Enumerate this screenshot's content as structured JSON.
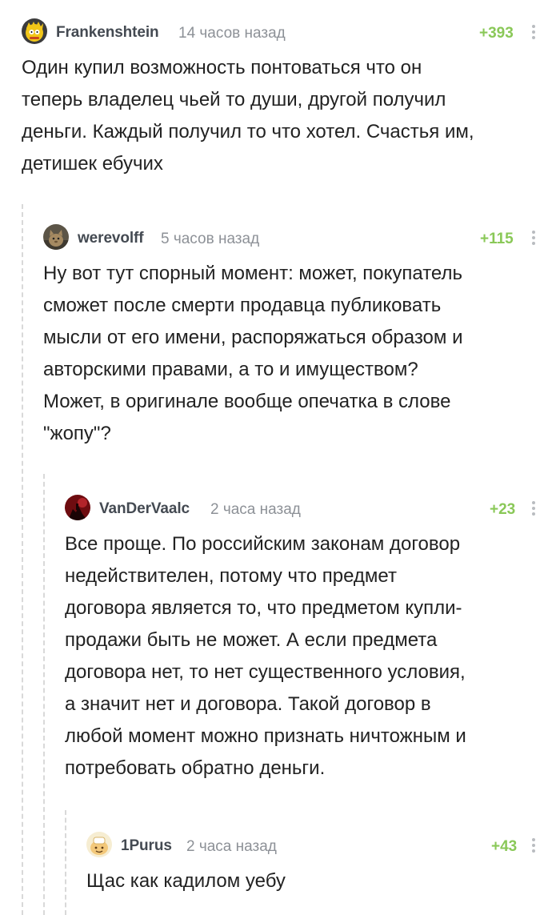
{
  "comments": [
    {
      "author": "Frankenshtein",
      "time": "14 часов назад",
      "rating": "+393",
      "avatar_icon": "bart-simpson-avatar",
      "lines": [
        "Один купил возможность понтоваться что он",
        "теперь владелец чьей то души, другой получил",
        "деньги. Каждый получил то что хотел. Счастья им,",
        "детишек ебучих"
      ]
    },
    {
      "author": "werevolff",
      "time": "5 часов назад",
      "rating": "+115",
      "avatar_icon": "cat-avatar",
      "lines": [
        "Ну вот тут спорный момент: может, покупатель",
        "сможет после смерти продавца публиковать",
        "мысли от его имени, распоряжаться образом и",
        "авторскими правами, а то и имуществом?",
        "Может, в оригинале вообще опечатка в слове",
        "\"жопу\"?"
      ]
    },
    {
      "author": "VanDerVaalc",
      "time": "2 часа назад",
      "rating": "+23",
      "avatar_icon": "dark-red-avatar",
      "lines": [
        "Все проще. По российским законам договор",
        "недействителен, потому что предмет",
        "договора является то, что предметом купли-",
        "продажи быть не может. А если предмета",
        "договора нет, то нет существенного условия,",
        "а значит нет и договора. Такой договор в",
        "любой момент можно признать ничтожным и",
        "потребовать обратно деньги."
      ]
    },
    {
      "author": "1Purus",
      "time": "2 часа назад",
      "rating": "+43",
      "avatar_icon": "cartoon-avatar",
      "lines": [
        "Щас как кадилом уебу"
      ]
    }
  ]
}
